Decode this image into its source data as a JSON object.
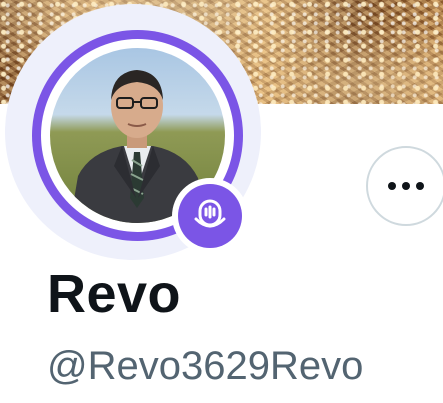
{
  "profile": {
    "display_name": "Revo",
    "handle": "@Revo3629Revo"
  },
  "icons": {
    "spaces": "spaces-microphone-icon",
    "more": "more-horizontal-icon"
  },
  "colors": {
    "spaces_ring": "#7b55e6",
    "name_text": "#0f1419",
    "handle_text": "#536471",
    "button_border": "#cfd9de"
  }
}
